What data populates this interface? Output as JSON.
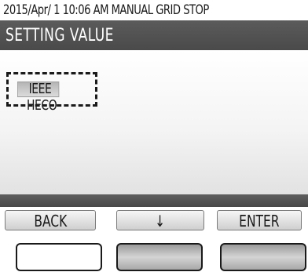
{
  "status_bar": {
    "text": "2015/Apr/ 1 10:06 AM   MANUAL GRID STOP"
  },
  "title_bar": {
    "title": "SETTING VALUE"
  },
  "options": {
    "selected": "IEEE",
    "other": "HECO"
  },
  "softkeys": {
    "back_label": "BACK",
    "down_label": "↓",
    "enter_label": "ENTER"
  },
  "colors": {
    "title_bar": "#4f4f4f",
    "highlight": "#c4c4c4"
  }
}
